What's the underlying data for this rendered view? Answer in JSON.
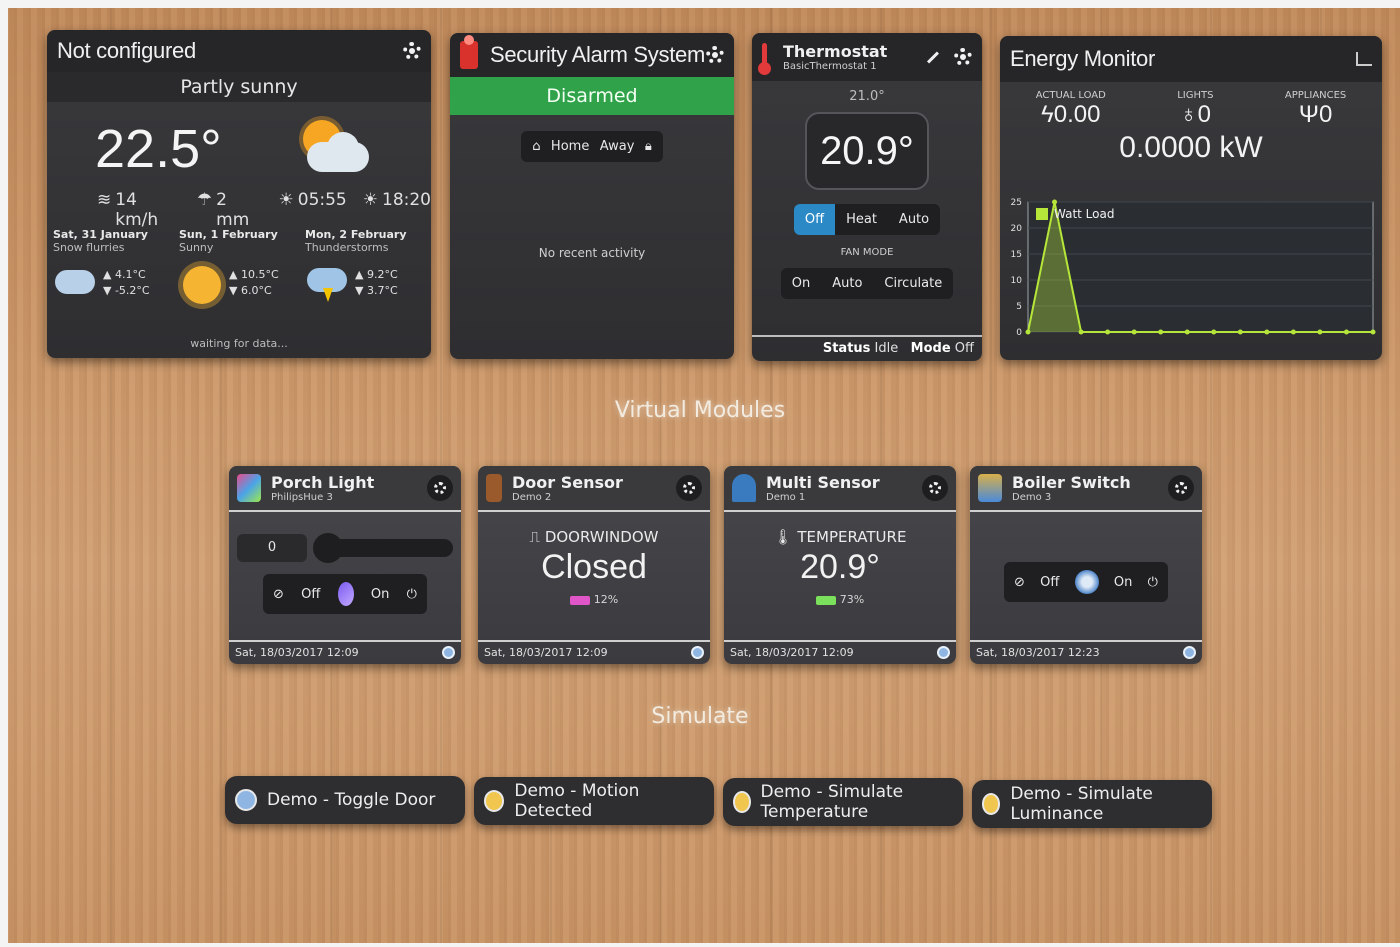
{
  "weather": {
    "title": "Not configured",
    "condition": "Partly sunny",
    "temperature": "22.5°",
    "wind": "14 km/h",
    "rain": "2 mm",
    "sunrise": "05:55",
    "sunset": "18:20",
    "forecast": [
      {
        "date": "Sat, 31 January",
        "cond": "Snow flurries",
        "high": "▲ 4.1°C",
        "low": "▼ -5.2°C",
        "icon": "snow-cloud-icon"
      },
      {
        "date": "Sun, 1 February",
        "cond": "Sunny",
        "high": "▲ 10.5°C",
        "low": "▼ 6.0°C",
        "icon": "sun-icon"
      },
      {
        "date": "Mon, 2 February",
        "cond": "Thunderstorms",
        "high": "▲ 9.2°C",
        "low": "▼ 3.7°C",
        "icon": "storm-icon"
      }
    ],
    "status": "waiting for data..."
  },
  "alarm": {
    "title": "Security Alarm System",
    "state": "Disarmed",
    "home": "Home",
    "away": "Away",
    "activity": "No recent activity",
    "state_color": "#2fa24a"
  },
  "thermostat": {
    "title": "Thermostat",
    "subtitle": "BasicThermostat 1",
    "setpoint": "21.0°",
    "current": "20.9°",
    "modes": [
      "Off",
      "Heat",
      "Auto"
    ],
    "active_mode": "Off",
    "fan_label": "FAN MODE",
    "fan_modes": [
      "On",
      "Auto",
      "Circulate"
    ],
    "status_label": "Status",
    "status_value": "Idle",
    "mode_label": "Mode",
    "mode_value": "Off"
  },
  "energy": {
    "title": "Energy Monitor",
    "actual_load_label": "ACTUAL LOAD",
    "actual_load": "0.00",
    "lights_label": "LIGHTS",
    "lights": "0",
    "appliances_label": "APPLIANCES",
    "appliances": "0",
    "total": "0.0000 kW",
    "legend": "Watt Load"
  },
  "chart_data": {
    "type": "line",
    "series": [
      {
        "name": "Watt Load",
        "values": [
          0,
          25,
          0,
          0,
          0,
          0,
          0,
          0,
          0,
          0,
          0,
          0,
          0,
          0
        ]
      }
    ],
    "x": [
      0,
      1,
      2,
      3,
      4,
      5,
      6,
      7,
      8,
      9,
      10,
      11,
      12,
      13
    ],
    "ylim": [
      0,
      25
    ],
    "yticks": [
      0,
      5,
      10,
      15,
      20,
      25
    ],
    "legend_position": "top-left",
    "grid": true,
    "color": "#b6e63a"
  },
  "sections": {
    "virtual": "Virtual Modules",
    "simulate": "Simulate"
  },
  "devices": [
    {
      "title": "Porch Light",
      "subtitle": "PhilipsHue 3",
      "level": "0",
      "off": "Off",
      "on": "On",
      "timestamp": "Sat, 18/03/2017 12:09"
    },
    {
      "title": "Door Sensor",
      "subtitle": "Demo 2",
      "label": "DOORWINDOW",
      "value": "Closed",
      "battery": "12%",
      "timestamp": "Sat, 18/03/2017 12:09"
    },
    {
      "title": "Multi Sensor",
      "subtitle": "Demo 1",
      "label": "TEMPERATURE",
      "value": "20.9°",
      "battery": "73%",
      "timestamp": "Sat, 18/03/2017 12:09"
    },
    {
      "title": "Boiler Switch",
      "subtitle": "Demo 3",
      "off": "Off",
      "on": "On",
      "timestamp": "Sat, 18/03/2017 12:23"
    }
  ],
  "scenes": [
    {
      "label": "Demo - Toggle Door"
    },
    {
      "label": "Demo - Motion Detected"
    },
    {
      "label": "Demo - Simulate Temperature"
    },
    {
      "label": "Demo - Simulate Luminance"
    }
  ]
}
